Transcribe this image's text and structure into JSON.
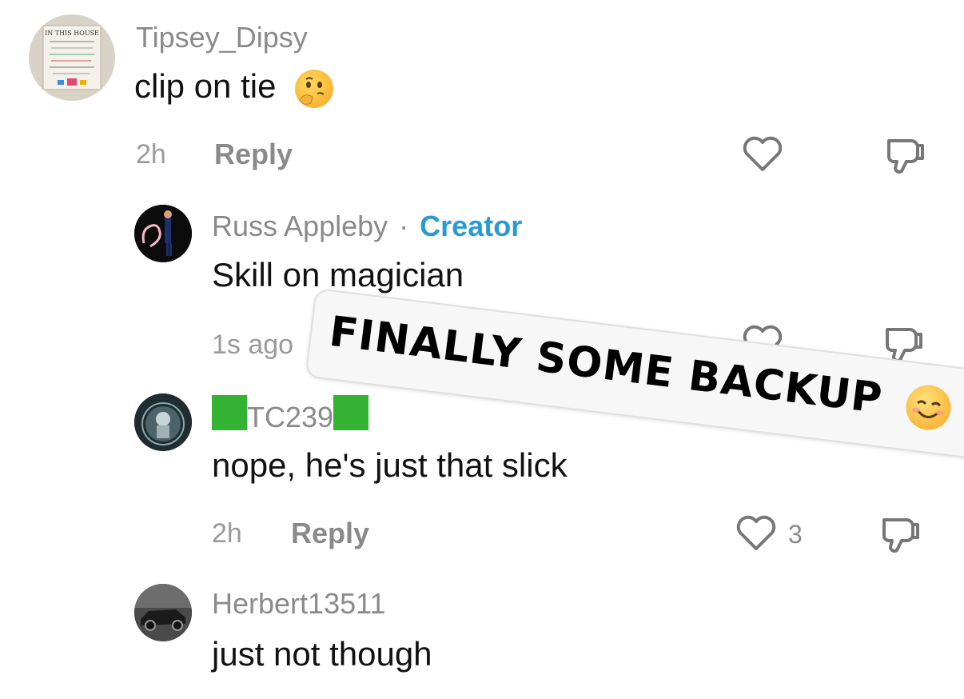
{
  "comments": [
    {
      "username": "Tipsey_Dipsy",
      "text": "clip on tie",
      "time": "2h",
      "reply": "Reply",
      "avatar_text": "IN THIS HOUSE"
    },
    {
      "username": "Russ Appleby",
      "creator_sep": "·",
      "creator_label": "Creator",
      "text": "Skill on magician",
      "time": "1s ago"
    },
    {
      "username": "TC239",
      "text": "nope, he's just that slick",
      "time": "2h",
      "reply": "Reply",
      "likes": "3"
    },
    {
      "username": "Herbert13511",
      "text": "just not though"
    }
  ],
  "overlay": {
    "text": "FINALLY SOME BACKUP"
  },
  "colors": {
    "creator": "#2a9bd1",
    "muted": "#8a8a8a",
    "text": "#111111",
    "emoji_square": "#34b233"
  },
  "icons": [
    "heart-icon",
    "dislike-icon",
    "thinking-emoji",
    "smiling-emoji"
  ]
}
